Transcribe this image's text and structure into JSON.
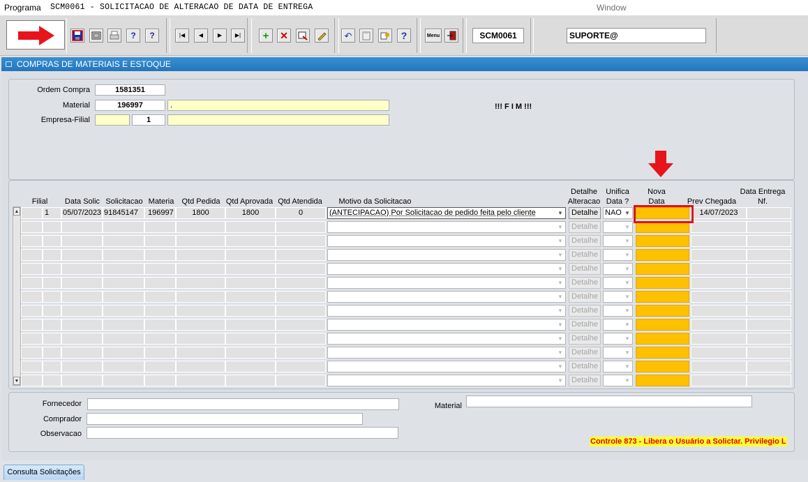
{
  "menubar": {
    "programa": "Programa",
    "title": "SCM0061 - SOLICITACAO DE ALTERACAO DE DATA DE ENTREGA",
    "window": "Window"
  },
  "toolbar": {
    "module_code": "SCM0061",
    "user": "SUPORTE@",
    "icons": [
      "red-arrow-indicator",
      "save-icon",
      "window-icon",
      "print-icon",
      "query-help-icon",
      "query-run-icon",
      "first-record-icon",
      "previous-record-icon",
      "next-record-icon",
      "last-record-icon",
      "insert-record-icon",
      "delete-record-icon",
      "clear-record-icon",
      "edit-record-icon",
      "undo-icon",
      "paste-icon",
      "list-values-icon",
      "help-icon",
      "menu-icon",
      "exit-icon"
    ],
    "menu_icon_text": "Menu"
  },
  "tab": {
    "title": "COMPRAS DE MATERIAIS E ESTOQUE"
  },
  "header": {
    "ordem_compra_label": "Ordem Compra",
    "ordem_compra": "1581351",
    "material_label": "Material",
    "material": "196997",
    "material_desc": ".",
    "empresa_filial_label": "Empresa-Filial",
    "empresa": "",
    "filial": "1",
    "empresa_desc": "",
    "status": "!!! F I M !!!"
  },
  "grid": {
    "columns": {
      "filial": "Filial",
      "data_solic": "Data Solic",
      "solicitacao": "Solicitacao",
      "material": "Materia",
      "qtd_pedida": "Qtd Pedida",
      "qtd_aprovada": "Qtd Aprovada",
      "qtd_atendida": "Qtd Atendida",
      "motivo": "Motivo da Solicitacao",
      "detalhe_l1": "Detalhe",
      "detalhe_l2": "Alteracao",
      "unifica_l1": "Unifica",
      "unifica_l2": "Data ?",
      "nova_l1": "Nova",
      "nova_l2": "Data",
      "prev_chegada": "Prev Chegada",
      "data_entrega_l1": "Data Entrega",
      "data_entrega_l2": "Nf."
    },
    "detalhe_label": "Detalhe",
    "rows": [
      {
        "filial": "1",
        "data_solic": "05/07/2023",
        "solicitacao": "91845147",
        "material": "196997",
        "qtd_pedida": "1800",
        "qtd_aprovada": "1800",
        "qtd_atendida": "0",
        "motivo": "(ANTECIPACAO) Por Solicitacao de pedido feita pelo cliente",
        "unifica": "NAO",
        "nova_data": "",
        "prev_chegada": "14/07/2023",
        "data_entrega_nf": ""
      }
    ],
    "empty_rows": 12
  },
  "footer": {
    "fornecedor_label": "Fornecedor",
    "fornecedor": "",
    "comprador_label": "Comprador",
    "comprador": "",
    "observacao_label": "Observacao",
    "observacao": "",
    "material_label": "Material",
    "material": "",
    "controle": "Controle 873 - Libera o Usuário a Solictar. Privilegio L"
  },
  "bottom_tab": "Consulta Solicitações",
  "colors": {
    "accent": "#2276bd",
    "highlight_field": "#ffc000",
    "annotation_red": "#e0121c"
  }
}
